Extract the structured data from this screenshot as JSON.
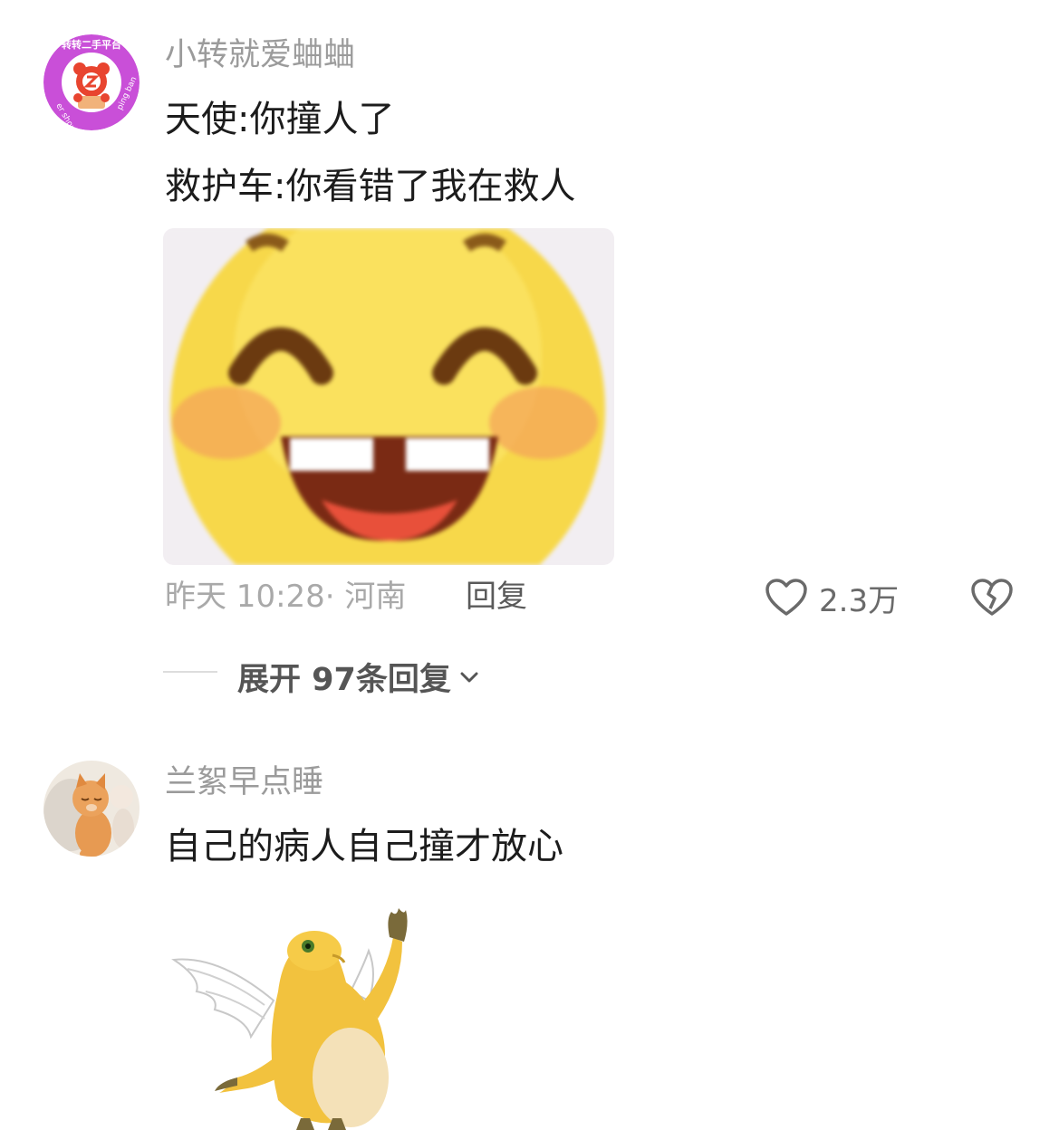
{
  "comments": [
    {
      "username": "小转就爱蛐蛐",
      "avatar_text_top": "转转二手平台",
      "avatar_text_left": "er shou",
      "avatar_text_right": "ping ban",
      "lines": [
        "天使:你撞人了",
        "救护车:你看错了我在救人"
      ],
      "time_location": "昨天 10:28· 河南",
      "reply_label": "回复",
      "like_count": "2.3万",
      "expand_label": "展开 97条回复"
    },
    {
      "username": "兰絮早点睡",
      "lines": [
        "自己的病人自己撞才放心"
      ]
    }
  ],
  "icons": {
    "like": "heart-outline-icon",
    "dislike": "broken-heart-icon",
    "expand": "chevron-down-icon"
  },
  "colors": {
    "username": "#9b9b9b",
    "text": "#1c1c1c",
    "meta": "#a9a9a9",
    "avatar_brand": "#c94fd8"
  }
}
